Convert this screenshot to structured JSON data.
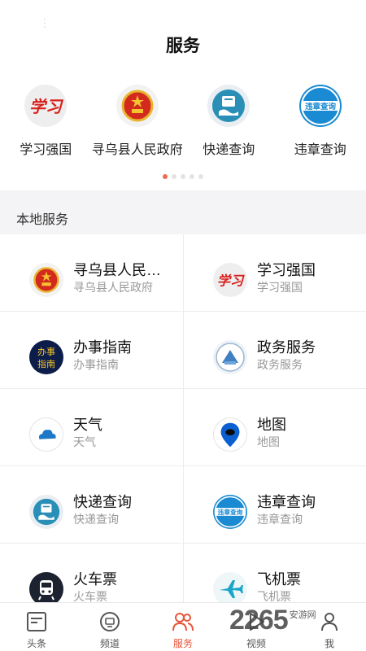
{
  "header": {
    "title": "服务"
  },
  "carousel": {
    "items": [
      {
        "label": "学习强国",
        "icon": "xuexi-qiangguo-icon"
      },
      {
        "label": "寻乌县人民政府",
        "icon": "national-emblem-icon"
      },
      {
        "label": "快递查询",
        "icon": "express-delivery-icon"
      },
      {
        "label": "违章查询",
        "icon": "traffic-violation-icon",
        "icon_text": "违章查询"
      }
    ],
    "page_count": 5,
    "active_page": 1
  },
  "section": {
    "title": "本地服务"
  },
  "services": [
    {
      "title": "寻乌县人民…",
      "subtitle": "寻乌县人民政府",
      "icon": "national-emblem-icon"
    },
    {
      "title": "学习强国",
      "subtitle": "学习强国",
      "icon": "xuexi-qiangguo-icon"
    },
    {
      "title": "办事指南",
      "subtitle": "办事指南",
      "icon": "service-guide-icon",
      "icon_text": [
        "办事",
        "指南"
      ]
    },
    {
      "title": "政务服务",
      "subtitle": "政务服务",
      "icon": "government-service-icon"
    },
    {
      "title": "天气",
      "subtitle": "天气",
      "icon": "weather-cloud-icon"
    },
    {
      "title": "地图",
      "subtitle": "地图",
      "icon": "map-pin-icon"
    },
    {
      "title": "快递查询",
      "subtitle": "快递查询",
      "icon": "express-delivery-icon"
    },
    {
      "title": "违章查询",
      "subtitle": "违章查询",
      "icon": "traffic-violation-icon",
      "icon_text": "违章查询"
    },
    {
      "title": "火车票",
      "subtitle": "火车票",
      "icon": "train-icon"
    },
    {
      "title": "飞机票",
      "subtitle": "飞机票",
      "icon": "airplane-icon"
    }
  ],
  "tabbar": {
    "tabs": [
      {
        "label": "头条",
        "icon": "headline-icon"
      },
      {
        "label": "频道",
        "icon": "channel-icon"
      },
      {
        "label": "服务",
        "icon": "service-people-icon"
      },
      {
        "label": "视频",
        "icon": "video-play-icon"
      },
      {
        "label": "我",
        "icon": "user-icon"
      }
    ],
    "active_index": 2
  },
  "watermark": {
    "big": "2265",
    "small": "安游网"
  },
  "colors": {
    "accent": "#e8553a",
    "section_bg": "#f4f4f6",
    "violation_blue": "#1a8ad2",
    "express_teal": "#2a8fb6",
    "dot_active": "#ef6a4c"
  }
}
